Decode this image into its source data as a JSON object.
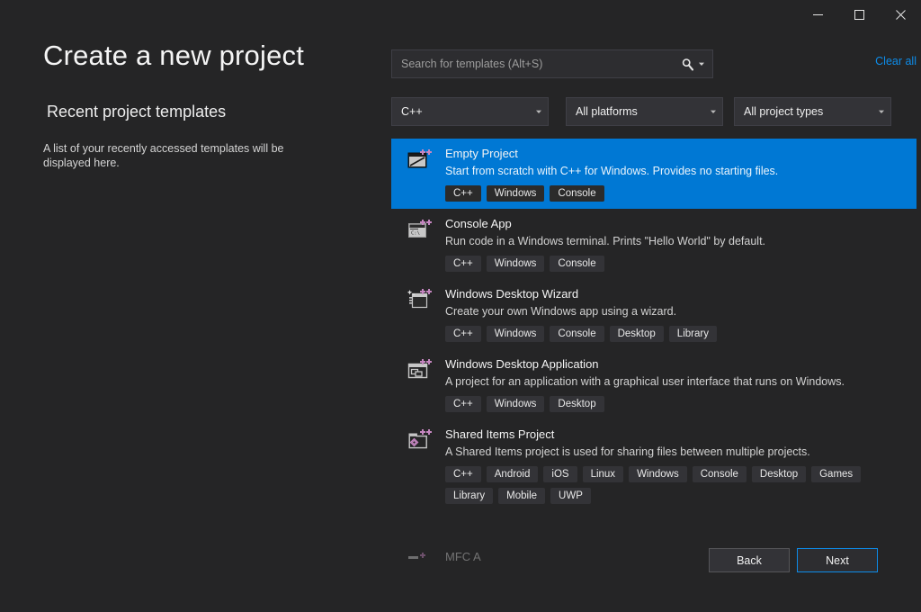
{
  "window": {
    "controls": [
      {
        "name": "minimize",
        "glyph": "minimize-icon"
      },
      {
        "name": "maximize",
        "glyph": "maximize-icon"
      },
      {
        "name": "close",
        "glyph": "close-icon"
      }
    ]
  },
  "left": {
    "title": "Create a new project",
    "recent_heading": "Recent project templates",
    "recent_empty_text": "A list of your recently accessed templates will be displayed here."
  },
  "search": {
    "placeholder": "Search for templates (Alt+S)",
    "value": "",
    "icon": "search-icon",
    "dropdown_icon": "chevron-down-icon",
    "clear_all_label": "Clear all",
    "clear_all_color": "#0d8ce9"
  },
  "filters": {
    "language": {
      "value": "C++"
    },
    "platform": {
      "value": "All platforms"
    },
    "project_type": {
      "value": "All project types"
    }
  },
  "templates": [
    {
      "name": "Empty Project",
      "description": "Start from scratch with C++ for Windows. Provides no starting files.",
      "tags": [
        "C++",
        "Windows",
        "Console"
      ],
      "icon": "empty-project-icon",
      "selected": true
    },
    {
      "name": "Console App",
      "description": "Run code in a Windows terminal. Prints \"Hello World\" by default.",
      "tags": [
        "C++",
        "Windows",
        "Console"
      ],
      "icon": "console-app-icon",
      "selected": false
    },
    {
      "name": "Windows Desktop Wizard",
      "description": "Create your own Windows app using a wizard.",
      "tags": [
        "C++",
        "Windows",
        "Console",
        "Desktop",
        "Library"
      ],
      "icon": "windows-desktop-wizard-icon",
      "selected": false
    },
    {
      "name": "Windows Desktop Application",
      "description": "A project for an application with a graphical user interface that runs on Windows.",
      "tags": [
        "C++",
        "Windows",
        "Desktop"
      ],
      "icon": "windows-desktop-application-icon",
      "selected": false
    },
    {
      "name": "Shared Items Project",
      "description": "A Shared Items project is used for sharing files between multiple projects.",
      "tags": [
        "C++",
        "Android",
        "iOS",
        "Linux",
        "Windows",
        "Console",
        "Desktop",
        "Games",
        "Library",
        "Mobile",
        "UWP"
      ],
      "icon": "shared-items-project-icon",
      "selected": false
    }
  ],
  "clipped_template": {
    "name": "MFC A"
  },
  "footer": {
    "back_label": "Back",
    "next_label": "Next"
  },
  "colors": {
    "background": "#252526",
    "selection": "#0078d4",
    "accent_link": "#0d8ce9",
    "tag_background": "#333337",
    "icon_plus": "#c586c0"
  }
}
